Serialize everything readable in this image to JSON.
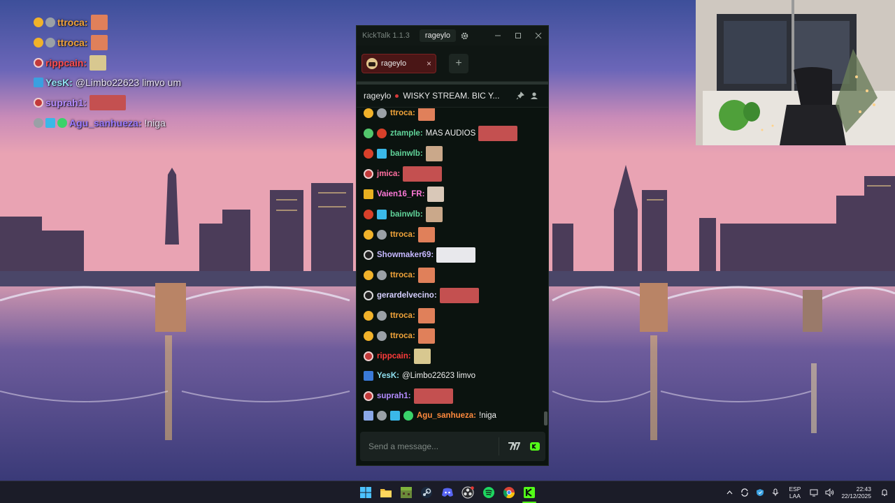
{
  "overlay": {
    "messages": [
      {
        "user": "ttroca",
        "sep": ":",
        "text": "",
        "color": "#f0a33a"
      },
      {
        "user": "ttroca",
        "sep": ":",
        "text": "",
        "color": "#f0a33a"
      },
      {
        "user": "rippcain",
        "sep": ":",
        "text": "",
        "color": "#ff4d4d"
      },
      {
        "user": "YesK",
        "sep": ":",
        "text": "@Limbo22623 limvo um",
        "color": "#8ee0f0"
      },
      {
        "user": "suprah1",
        "sep": ":",
        "text": "",
        "color": "#b48cff"
      },
      {
        "user": "Agu_sanhueza",
        "sep": ":",
        "text": "!niga",
        "color": "#9b7bff"
      }
    ]
  },
  "app": {
    "title": "KickTalk 1.1.3",
    "account": "rageylo",
    "icons": {
      "settings": "gear-icon",
      "minimize": "minimize-icon",
      "maximize": "maximize-icon",
      "close": "close-icon"
    }
  },
  "tabs": {
    "items": [
      {
        "label": "rageylo",
        "close": "×"
      }
    ],
    "add": "+"
  },
  "stream": {
    "channel": "rageylo",
    "title": "WISKY STREAM. BIC Y...",
    "live_color": "#d63a3a"
  },
  "chat": {
    "messages": [
      {
        "user": "ttroca",
        "sep": ":",
        "text": "",
        "color": "#f0a33a"
      },
      {
        "user": "ztample",
        "sep": ":",
        "text": "MAS AUDIOS",
        "color": "#61d49a"
      },
      {
        "user": "bainwlb",
        "sep": ":",
        "text": "",
        "color": "#61d49a"
      },
      {
        "user": "jmica",
        "sep": ":",
        "text": "",
        "color": "#ff6fa0"
      },
      {
        "user": "Vaien16_FR",
        "sep": ":",
        "text": "",
        "color": "#ff7ad9"
      },
      {
        "user": "bainwlb",
        "sep": ":",
        "text": "",
        "color": "#61d49a"
      },
      {
        "user": "ttroca",
        "sep": ":",
        "text": "",
        "color": "#f0a33a"
      },
      {
        "user": "Showmaker69",
        "sep": ":",
        "text": "",
        "color": "#c6b8ff"
      },
      {
        "user": "ttroca",
        "sep": ":",
        "text": "",
        "color": "#f0a33a"
      },
      {
        "user": "gerardelvecino",
        "sep": ":",
        "text": "",
        "color": "#d6d0ff"
      },
      {
        "user": "ttroca",
        "sep": ":",
        "text": "",
        "color": "#f0a33a"
      },
      {
        "user": "ttroca",
        "sep": ":",
        "text": "",
        "color": "#f0a33a"
      },
      {
        "user": "rippcain",
        "sep": ":",
        "text": "",
        "color": "#ff3b3b"
      },
      {
        "user": "YesK",
        "sep": ":",
        "text": "@Limbo22623 limvo",
        "color": "#8ee0f0"
      },
      {
        "user": "suprah1",
        "sep": ":",
        "text": "",
        "color": "#b48cff"
      },
      {
        "user": "Agu_sanhueza",
        "sep": ":",
        "text": "!niga",
        "color": "#ff8a3d"
      }
    ]
  },
  "composer": {
    "placeholder": "Send a message...",
    "emote_button_icon": "7tv-icon",
    "kick_button_icon": "kick-emote-icon"
  },
  "taskbar": {
    "apps": [
      "windows-start-icon",
      "file-explorer-icon",
      "minecraft-icon",
      "steam-icon",
      "discord-icon",
      "obs-icon",
      "spotify-icon",
      "chrome-icon",
      "kick-icon"
    ],
    "tray": {
      "lang_top": "ESP",
      "lang_bottom": "LAA",
      "time": "22:43",
      "date": "22/12/2025"
    }
  }
}
